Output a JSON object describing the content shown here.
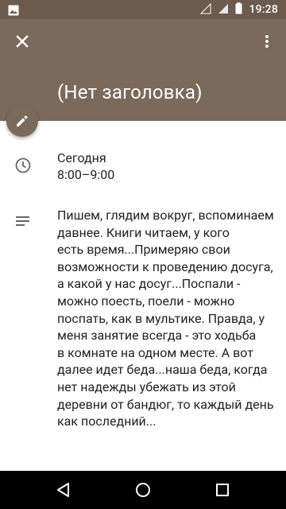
{
  "status_bar": {
    "time": "19:28",
    "icons": [
      "gallery-icon",
      "wifi-icon",
      "signal-icon",
      "battery-icon"
    ]
  },
  "header": {
    "title": "(Нет заголовка)",
    "color": "#7a6a5c",
    "actions": [
      "close-icon",
      "more-vert-icon",
      "edit-icon"
    ]
  },
  "event": {
    "day": "Сегодня",
    "time_range": "8:00–9:00",
    "description": "Пишем, глядим вокруг, вспоминаем давнее. Книги читаем, у кого\nесть время...Примеряю свои возможности к проведению досуга, а какой у нас досуг...Поспали - можно поесть, поели - можно поспать, как в мультике. Правда, у меня занятие всегда - это ходьба\nв комнате на одном месте. А вот далее идет беда...наша беда, когда нет надежды убежать из этой деревни от бандюг, то каждый день как последний..."
  },
  "nav_bar": {
    "buttons": [
      "back-icon",
      "home-icon",
      "recents-icon"
    ]
  }
}
